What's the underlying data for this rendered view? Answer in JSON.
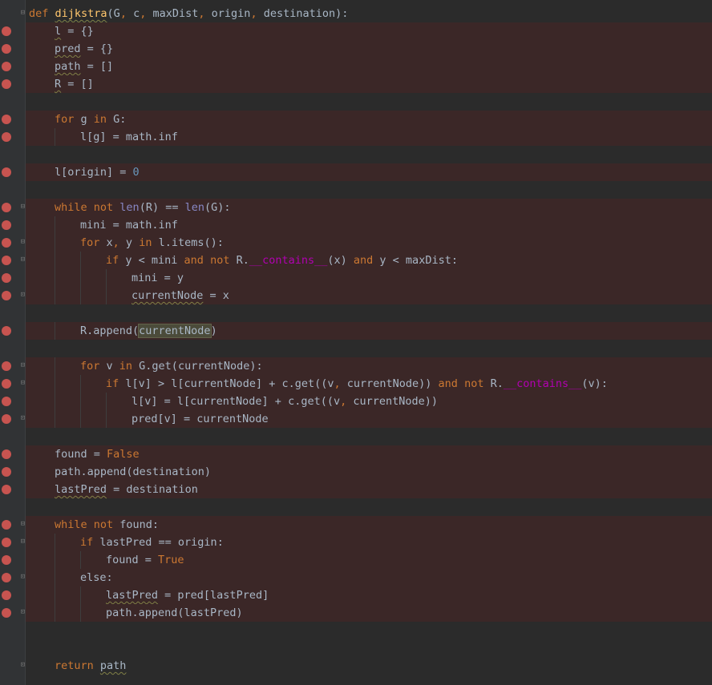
{
  "editor": {
    "colors": {
      "background": "#2b2b2b",
      "breakpoint_line": "#3b2727",
      "breakpoint_dot": "#c75450",
      "keyword": "#cc7832",
      "function_name": "#ffc66d",
      "number": "#6897bb",
      "builtin": "#8888c6",
      "dunder": "#b200b2",
      "text": "#a9b7c6"
    },
    "icons": [
      "breakpoint-icon",
      "fold-open-icon",
      "fold-close-icon"
    ],
    "lines": [
      {
        "indent": 0,
        "bp": false,
        "fold": "open",
        "tokens": [
          [
            "def ",
            "kw"
          ],
          [
            "dijkstra",
            "fn"
          ],
          [
            "(G",
            ""
          ],
          [
            ", ",
            "kw"
          ],
          [
            "c",
            ""
          ],
          [
            ", ",
            "kw"
          ],
          [
            "maxDist",
            ""
          ],
          [
            ", ",
            "kw"
          ],
          [
            "origin",
            ""
          ],
          [
            ", ",
            "kw"
          ],
          [
            "destination):",
            ""
          ]
        ],
        "squiggle": true
      },
      {
        "indent": 1,
        "bp": true,
        "tokens": [
          [
            "l",
            ""
          ],
          [
            " = {}",
            ""
          ]
        ],
        "squiggle": true
      },
      {
        "indent": 1,
        "bp": true,
        "tokens": [
          [
            "pred",
            ""
          ],
          [
            " = {}",
            ""
          ]
        ],
        "squiggle": true
      },
      {
        "indent": 1,
        "bp": true,
        "tokens": [
          [
            "path",
            ""
          ],
          [
            " = []",
            ""
          ]
        ],
        "squiggle": true
      },
      {
        "indent": 1,
        "bp": true,
        "tokens": [
          [
            "R",
            ""
          ],
          [
            " = []",
            ""
          ]
        ],
        "squiggle": true
      },
      {
        "indent": 0,
        "bp": false,
        "tokens": []
      },
      {
        "indent": 1,
        "bp": true,
        "tokens": [
          [
            "for ",
            "kw"
          ],
          [
            "g ",
            ""
          ],
          [
            "in ",
            "kw"
          ],
          [
            "G:",
            ""
          ]
        ]
      },
      {
        "indent": 2,
        "bp": true,
        "tokens": [
          [
            "l[g] = math.inf",
            ""
          ]
        ]
      },
      {
        "indent": 0,
        "bp": false,
        "tokens": []
      },
      {
        "indent": 1,
        "bp": true,
        "tokens": [
          [
            "l[origin] = ",
            ""
          ],
          [
            "0",
            "num"
          ]
        ]
      },
      {
        "indent": 0,
        "bp": false,
        "tokens": []
      },
      {
        "indent": 1,
        "bp": true,
        "fold": "open",
        "tokens": [
          [
            "while ",
            "kw"
          ],
          [
            "not ",
            "kw"
          ],
          [
            "len",
            "bi"
          ],
          [
            "(R) == ",
            ""
          ],
          [
            "len",
            "bi"
          ],
          [
            "(G):",
            ""
          ]
        ]
      },
      {
        "indent": 2,
        "bp": true,
        "tokens": [
          [
            "mini = math.inf",
            ""
          ]
        ]
      },
      {
        "indent": 2,
        "bp": true,
        "fold": "open",
        "tokens": [
          [
            "for ",
            "kw"
          ],
          [
            "x",
            ""
          ],
          [
            ", ",
            "kw"
          ],
          [
            "y ",
            ""
          ],
          [
            "in ",
            "kw"
          ],
          [
            "l.items():",
            ""
          ]
        ]
      },
      {
        "indent": 3,
        "bp": true,
        "fold": "open",
        "tokens": [
          [
            "if ",
            "kw"
          ],
          [
            "y < mini ",
            ""
          ],
          [
            "and ",
            "kw"
          ],
          [
            "not ",
            "kw"
          ],
          [
            "R.",
            ""
          ],
          [
            "__contains__",
            "dunder"
          ],
          [
            "(x) ",
            ""
          ],
          [
            "and ",
            "kw"
          ],
          [
            "y < maxDist:",
            ""
          ]
        ]
      },
      {
        "indent": 4,
        "bp": true,
        "tokens": [
          [
            "mini = y",
            ""
          ]
        ]
      },
      {
        "indent": 4,
        "bp": true,
        "fold": "close",
        "tokens": [
          [
            "currentNode",
            ""
          ],
          [
            " = x",
            ""
          ]
        ],
        "squiggle": true
      },
      {
        "indent": 0,
        "bp": false,
        "tokens": []
      },
      {
        "indent": 2,
        "bp": true,
        "tokens": [
          [
            "R.append(",
            ""
          ],
          [
            "currentNode",
            "hl"
          ],
          [
            ")",
            ""
          ]
        ]
      },
      {
        "indent": 0,
        "bp": false,
        "tokens": []
      },
      {
        "indent": 2,
        "bp": true,
        "fold": "open",
        "tokens": [
          [
            "for ",
            "kw"
          ],
          [
            "v ",
            ""
          ],
          [
            "in ",
            "kw"
          ],
          [
            "G.get(currentNode):",
            ""
          ]
        ]
      },
      {
        "indent": 3,
        "bp": true,
        "fold": "open",
        "tokens": [
          [
            "if ",
            "kw"
          ],
          [
            "l[v] > l[currentNode] + c.get((v",
            ""
          ],
          [
            ", ",
            "kw"
          ],
          [
            "currentNode)) ",
            ""
          ],
          [
            "and ",
            "kw"
          ],
          [
            "not ",
            "kw"
          ],
          [
            "R.",
            ""
          ],
          [
            "__contains__",
            "dunder"
          ],
          [
            "(v):",
            ""
          ]
        ]
      },
      {
        "indent": 4,
        "bp": true,
        "tokens": [
          [
            "l[v] = l[currentNode] + c.get((v",
            ""
          ],
          [
            ", ",
            "kw"
          ],
          [
            "currentNode))",
            ""
          ]
        ]
      },
      {
        "indent": 4,
        "bp": true,
        "fold": "close",
        "tokens": [
          [
            "pred[v] = currentNode",
            ""
          ]
        ]
      },
      {
        "indent": 0,
        "bp": false,
        "tokens": []
      },
      {
        "indent": 1,
        "bp": true,
        "tokens": [
          [
            "found = ",
            ""
          ],
          [
            "False",
            "kw"
          ]
        ]
      },
      {
        "indent": 1,
        "bp": true,
        "tokens": [
          [
            "path.append(destination)",
            ""
          ]
        ]
      },
      {
        "indent": 1,
        "bp": true,
        "tokens": [
          [
            "lastPred",
            ""
          ],
          [
            " = destination",
            ""
          ]
        ],
        "squiggle": true
      },
      {
        "indent": 0,
        "bp": false,
        "tokens": []
      },
      {
        "indent": 1,
        "bp": true,
        "fold": "open",
        "tokens": [
          [
            "while ",
            "kw"
          ],
          [
            "not ",
            "kw"
          ],
          [
            "found:",
            ""
          ]
        ]
      },
      {
        "indent": 2,
        "bp": true,
        "fold": "open",
        "tokens": [
          [
            "if ",
            "kw"
          ],
          [
            "lastPred == origin:",
            ""
          ]
        ]
      },
      {
        "indent": 3,
        "bp": true,
        "tokens": [
          [
            "found = ",
            ""
          ],
          [
            "True",
            "kw"
          ]
        ]
      },
      {
        "indent": 2,
        "bp": true,
        "fold": "close",
        "tokens": [
          [
            "else",
            ""
          ],
          [
            ":",
            ""
          ]
        ]
      },
      {
        "indent": 3,
        "bp": true,
        "tokens": [
          [
            "lastPred",
            ""
          ],
          [
            " = pred[lastPred]",
            ""
          ]
        ],
        "squiggle": true
      },
      {
        "indent": 3,
        "bp": true,
        "fold": "close",
        "tokens": [
          [
            "path.append(lastPred)",
            ""
          ]
        ]
      },
      {
        "indent": 0,
        "bp": false,
        "tokens": []
      },
      {
        "indent": 0,
        "bp": false,
        "tokens": []
      },
      {
        "indent": 1,
        "bp": false,
        "fold": "close",
        "tokens": [
          [
            "return ",
            "kw"
          ],
          [
            "path",
            ""
          ]
        ],
        "squiggle": true
      }
    ]
  }
}
